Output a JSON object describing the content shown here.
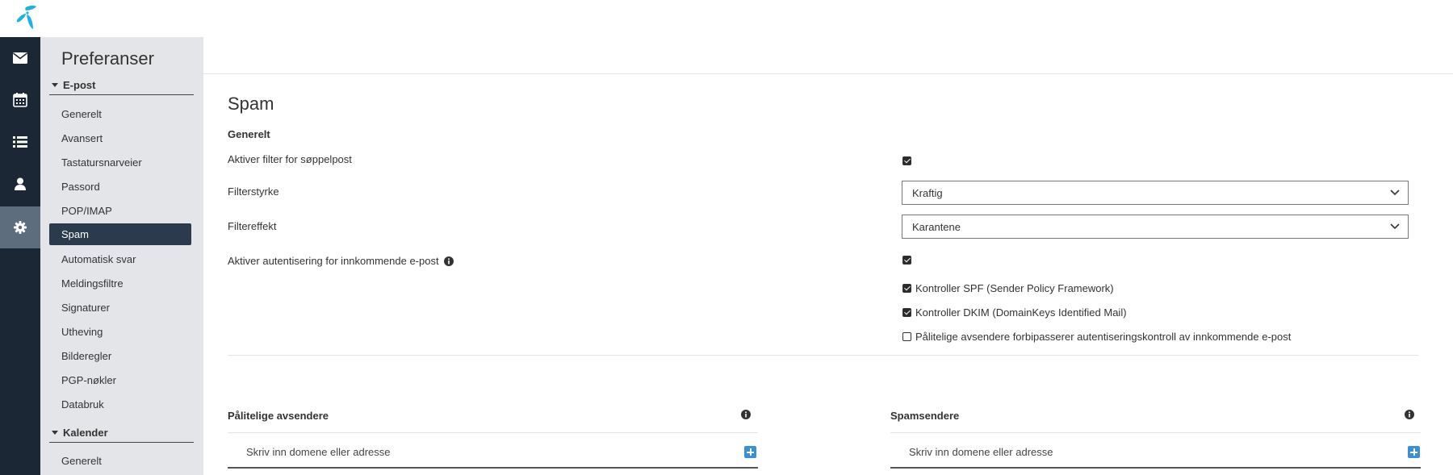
{
  "brand": {
    "logo_icon": "telenor-propeller-icon",
    "accent": "#1ab3e6"
  },
  "rail": {
    "items": [
      {
        "icon": "mail-icon"
      },
      {
        "icon": "calendar-icon"
      },
      {
        "icon": "list-icon"
      },
      {
        "icon": "person-icon"
      },
      {
        "icon": "gear-icon",
        "active": true
      }
    ]
  },
  "sidebar": {
    "title": "Preferanser",
    "sections": [
      {
        "label": "E-post",
        "items": [
          "Generelt",
          "Avansert",
          "Tastatursnarveier",
          "Passord",
          "POP/IMAP",
          "Spam",
          "Automatisk svar",
          "Meldingsfiltre",
          "Signaturer",
          "Utheving",
          "Bilderegler",
          "PGP-nøkler",
          "Databruk"
        ],
        "active": "Spam"
      },
      {
        "label": "Kalender",
        "items": [
          "Generelt"
        ]
      }
    ]
  },
  "main": {
    "title": "Spam",
    "section_heading": "Generelt",
    "enable_filter_label": "Aktiver filter for søppelpost",
    "enable_filter_checked": true,
    "filter_strength_label": "Filterstyrke",
    "filter_strength_value": "Kraftig",
    "filter_effect_label": "Filtereffekt",
    "filter_effect_value": "Karantene",
    "enable_auth_label": "Aktiver autentisering for innkommende e-post",
    "enable_auth_checked": true,
    "check_spf_label": "Kontroller SPF (Sender Policy Framework)",
    "check_spf_checked": true,
    "check_dkim_label": "Kontroller DKIM (DomainKeys Identified Mail)",
    "check_dkim_checked": true,
    "trusted_bypass_label": "Pålitelige avsendere forbipasserer autentiseringskontroll av innkommende e-post",
    "trusted_bypass_checked": false
  },
  "trusted": {
    "heading": "Pålitelige avsendere",
    "placeholder": "Skriv inn domene eller adresse"
  },
  "spam_senders": {
    "heading": "Spamsendere",
    "placeholder": "Skriv inn domene eller adresse"
  }
}
